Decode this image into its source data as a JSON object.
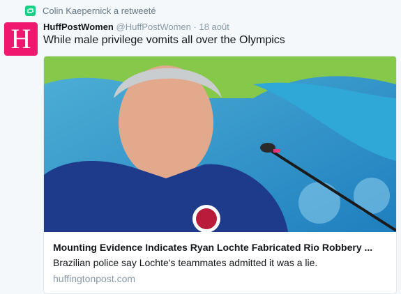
{
  "retweet": {
    "text": "Colin Kaepernick a retweeté",
    "icon": "retweet-icon",
    "color": "#19cf86"
  },
  "author": {
    "avatar_letter": "H",
    "avatar_color": "#f0176f",
    "display_name": "HuffPostWomen",
    "handle": "@HuffPostWomen",
    "separator": "·",
    "date": "18 août"
  },
  "tweet": {
    "text": "While male privilege vomits all over the Olympics"
  },
  "card": {
    "image_description": "swimmer-press-conference-photo",
    "title": "Mounting Evidence Indicates Ryan Lochte Fabricated Rio Robbery ...",
    "description": "Brazilian police say Lochte's teammates admitted it was a lie.",
    "domain": "huffingtonpost.com"
  }
}
